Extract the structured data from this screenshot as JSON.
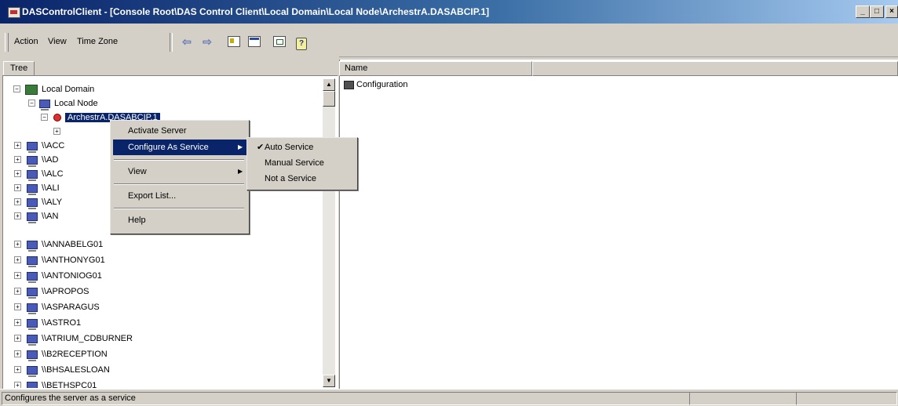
{
  "window": {
    "title": "DASControlClient - [Console Root\\DAS Control Client\\Local Domain\\Local Node\\ArchestrA.DASABCIP.1]",
    "controls": {
      "minimize": "_",
      "restore": "□",
      "close": "×"
    }
  },
  "menu": {
    "action": "Action",
    "view": "View",
    "time_zone": "Time Zone"
  },
  "toolbar": {
    "back_icon": "⇦",
    "forward_icon": "⇨",
    "help_glyph": "?"
  },
  "tree": {
    "tab_label": "Tree",
    "domain": "Local Domain",
    "node": "Local Node",
    "selected": "ArchestrA.DASABCIP.1",
    "child_truncated": "",
    "computers_truncated": [
      "\\\\ACC",
      "\\\\AD",
      "\\\\ALC",
      "\\\\ALI",
      "\\\\ALY",
      "\\\\AN"
    ],
    "computers": [
      "\\\\ANNABELG01",
      "\\\\ANTHONYG01",
      "\\\\ANTONIOG01",
      "\\\\APROPOS",
      "\\\\ASPARAGUS",
      "\\\\ASTRO1",
      "\\\\ATRIUM_CDBURNER",
      "\\\\B2RECEPTION",
      "\\\\BHSALESLOAN",
      "\\\\BETHSPC01"
    ]
  },
  "list": {
    "columns": [
      "Name",
      ""
    ],
    "items": [
      "Configuration"
    ]
  },
  "context_menu": {
    "items": [
      "Activate Server",
      "Configure As Service",
      "View",
      "Export List...",
      "Help"
    ],
    "highlighted": "Configure As Service"
  },
  "submenu": {
    "items": [
      "Auto Service",
      "Manual Service",
      "Not a Service"
    ],
    "checked": "Auto Service",
    "checkmark": "✔"
  },
  "status": {
    "text": "Configures the server as a service"
  }
}
